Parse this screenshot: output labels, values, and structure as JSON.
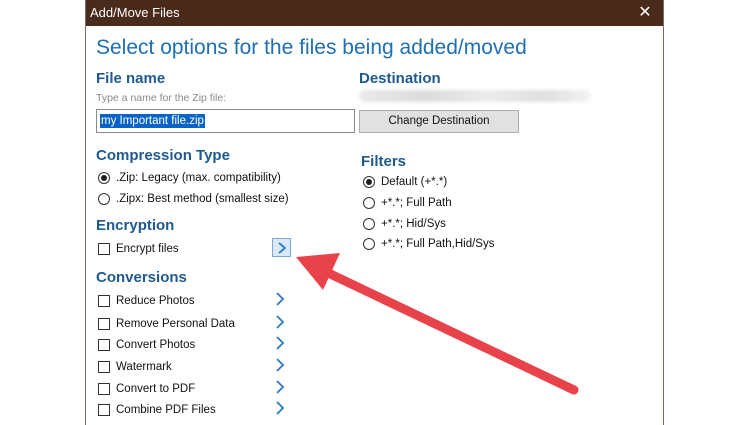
{
  "window": {
    "title": "Add/Move Files",
    "close_glyph": "✕"
  },
  "heading": "Select options for the files being added/moved",
  "file_name": {
    "title": "File name",
    "hint": "Type a name for the Zip file:",
    "value": "my Important file.zip"
  },
  "destination": {
    "title": "Destination",
    "button_label": "Change Destination"
  },
  "compression": {
    "title": "Compression Type",
    "options": [
      {
        "label": ".Zip: Legacy (max. compatibility)",
        "selected": true
      },
      {
        "label": ".Zipx: Best method (smallest size)",
        "selected": false
      }
    ]
  },
  "filters": {
    "title": "Filters",
    "options": [
      {
        "label": "Default (+*.*)",
        "selected": true
      },
      {
        "label": "+*.*; Full Path",
        "selected": false
      },
      {
        "label": "+*.*; Hid/Sys",
        "selected": false
      },
      {
        "label": "+*.*; Full Path,Hid/Sys",
        "selected": false
      }
    ]
  },
  "encryption": {
    "title": "Encryption",
    "items": [
      {
        "label": "Encrypt files",
        "checked": false
      }
    ]
  },
  "conversions": {
    "title": "Conversions",
    "items": [
      {
        "label": "Reduce Photos",
        "checked": false
      },
      {
        "label": "Remove Personal Data",
        "checked": false
      },
      {
        "label": "Convert Photos",
        "checked": false
      },
      {
        "label": "Watermark",
        "checked": false
      },
      {
        "label": "Convert to PDF",
        "checked": false
      },
      {
        "label": "Combine PDF Files",
        "checked": false
      }
    ]
  },
  "icons": {
    "chevron": "chevron-right-icon",
    "close": "close-icon",
    "annotation": "red-arrow-annotation"
  },
  "colors": {
    "titlebar": "#4a2a1a",
    "heading": "#1f6fb3",
    "section_title": "#1f5a8f",
    "selection": "#0a64c8",
    "chevron": "#2a7ac7",
    "annotation_arrow": "#e8424a"
  }
}
